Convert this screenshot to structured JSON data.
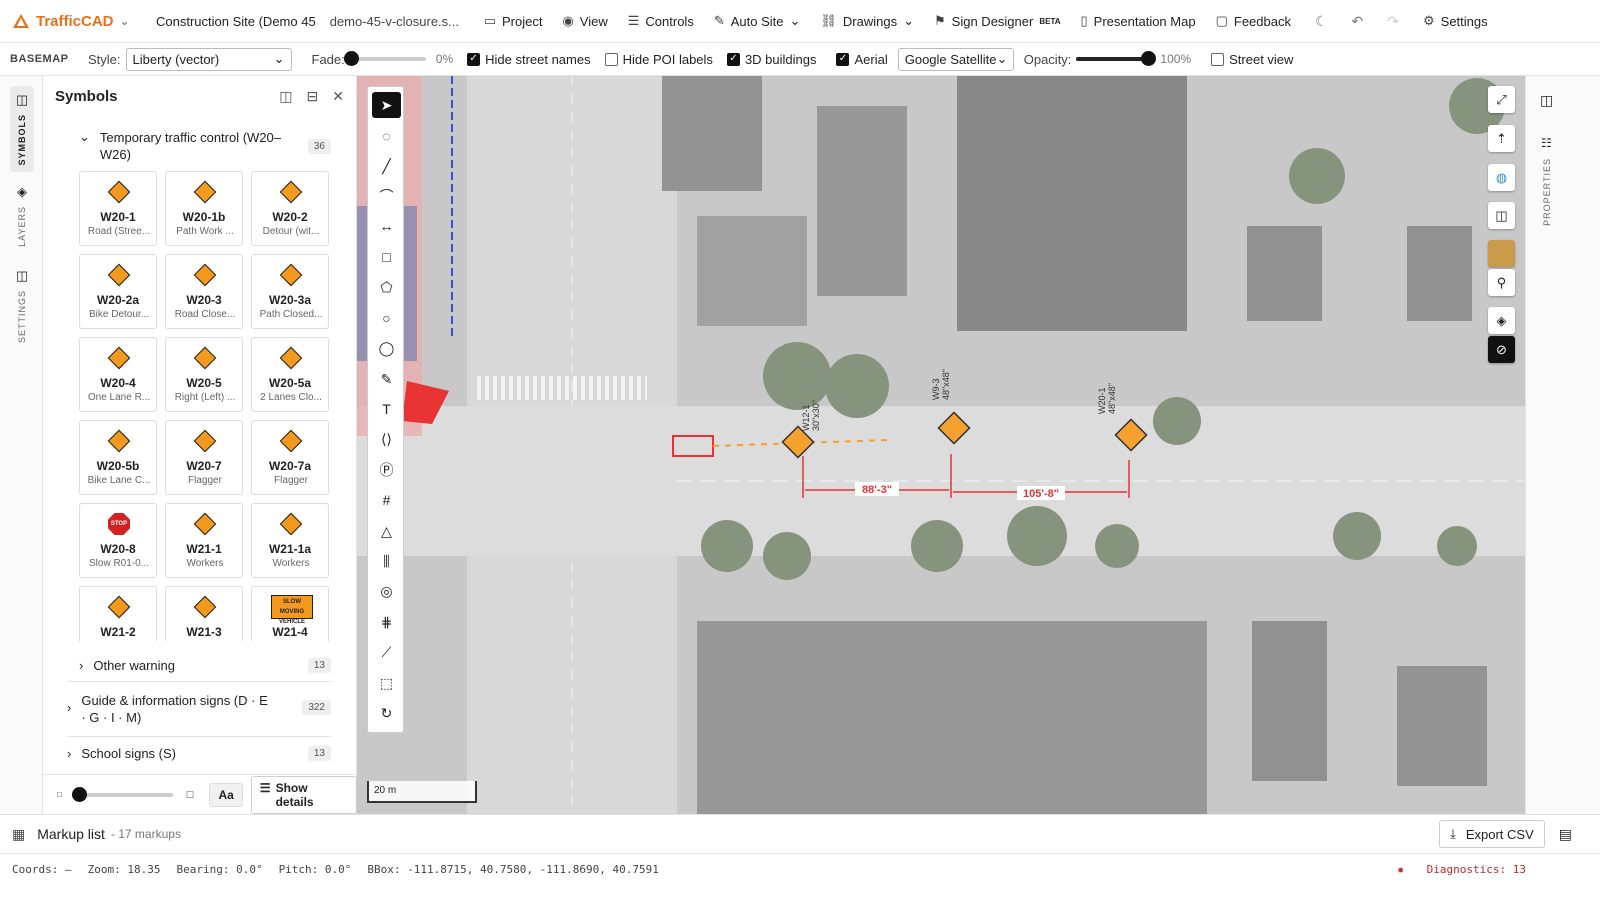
{
  "app": {
    "name": "TrafficCAD"
  },
  "header": {
    "project_title": "Construction Site (Demo 45",
    "file_name": "demo-45-v-closure.s...",
    "menus": [
      {
        "label": "Project",
        "icon": "folder-icon"
      },
      {
        "label": "View",
        "icon": "eye-icon"
      },
      {
        "label": "Controls",
        "icon": "sliders-icon"
      },
      {
        "label": "Auto Site",
        "icon": "magic-wand-icon"
      },
      {
        "label": "Drawings",
        "icon": "link-icon"
      },
      {
        "label": "Sign Designer",
        "icon": "signpost-icon",
        "badge": "BETA"
      },
      {
        "label": "Presentation Map",
        "icon": "book-icon"
      },
      {
        "label": "Feedback",
        "icon": "chat-icon"
      }
    ],
    "settings_label": "Settings"
  },
  "basemap": {
    "title": "BASEMAP",
    "style_label": "Style:",
    "style_value": "Liberty (vector)",
    "fade_label": "Fade:",
    "fade_pct": "0%",
    "fade_value": 0,
    "hide_street_names": {
      "label": "Hide street names",
      "checked": true
    },
    "hide_poi_labels": {
      "label": "Hide POI labels",
      "checked": false
    },
    "buildings_3d": {
      "label": "3D buildings",
      "checked": true
    },
    "aerial": {
      "label": "Aerial",
      "checked": true
    },
    "aerial_source": "Google Satellite",
    "opacity_label": "Opacity:",
    "opacity_pct": "100%",
    "opacity_value": 1.0,
    "street_view": {
      "label": "Street view",
      "checked": false
    }
  },
  "left_rail": {
    "symbols": "SYMBOLS",
    "layers": "LAYERS",
    "settings": "SETTINGS"
  },
  "symbols_panel": {
    "title": "Symbols",
    "open_group": {
      "label": "Temporary traffic control (W20–W26)",
      "count": "36"
    },
    "tiles": [
      {
        "code": "W20-1",
        "desc": "Road (Stree...",
        "kind": "diamond"
      },
      {
        "code": "W20-1b",
        "desc": "Path Work ...",
        "kind": "diamond"
      },
      {
        "code": "W20-2",
        "desc": "Detour (wit...",
        "kind": "diamond"
      },
      {
        "code": "W20-2a",
        "desc": "Bike Detour...",
        "kind": "diamond"
      },
      {
        "code": "W20-3",
        "desc": "Road Close...",
        "kind": "diamond"
      },
      {
        "code": "W20-3a",
        "desc": "Path Closed...",
        "kind": "diamond"
      },
      {
        "code": "W20-4",
        "desc": "One Lane R...",
        "kind": "diamond"
      },
      {
        "code": "W20-5",
        "desc": "Right (Left) ...",
        "kind": "diamond"
      },
      {
        "code": "W20-5a",
        "desc": "2 Lanes Clo...",
        "kind": "diamond"
      },
      {
        "code": "W20-5b",
        "desc": "Bike Lane C...",
        "kind": "diamond"
      },
      {
        "code": "W20-7",
        "desc": "Flagger",
        "kind": "diamond"
      },
      {
        "code": "W20-7a",
        "desc": "Flagger",
        "kind": "diamond"
      },
      {
        "code": "W20-8",
        "desc": "Slow R01-0...",
        "kind": "stop"
      },
      {
        "code": "W21-1",
        "desc": "Workers",
        "kind": "diamond"
      },
      {
        "code": "W21-1a",
        "desc": "Workers",
        "kind": "diamond"
      },
      {
        "code": "W21-2",
        "desc": "",
        "kind": "diamond"
      },
      {
        "code": "W21-3",
        "desc": "",
        "kind": "diamond"
      },
      {
        "code": "W21-4",
        "desc": "",
        "kind": "rect",
        "sign_text": "SLOW MOVING VEHICLE"
      }
    ],
    "stop_text": "STOP",
    "other_groups": [
      {
        "label": "Other warning",
        "count": "13"
      },
      {
        "label": "Guide & information signs (D · E · G · I · M)",
        "count": "322"
      },
      {
        "label": "School signs (S)",
        "count": "13"
      }
    ],
    "font_toggle": "Aa",
    "show_details": "Show details"
  },
  "map": {
    "scale_label": "20 m",
    "signs": [
      {
        "code": "W12-1",
        "size": "30\"x30\""
      },
      {
        "code": "W9-3",
        "size": "48\"x48\""
      },
      {
        "code": "W20-1",
        "size": "48\"x48\""
      }
    ],
    "dimensions": [
      "88'-3\"",
      "105'-8\""
    ]
  },
  "right_rail": {
    "properties": "PROPERTIES"
  },
  "markup": {
    "title": "Markup list",
    "count_text": "- 17 markups",
    "export_label": "Export CSV"
  },
  "status": {
    "coords": "Coords: —",
    "zoom": "Zoom: 18.35",
    "bearing": "Bearing: 0.0°",
    "pitch": "Pitch: 0.0°",
    "bbox": "BBox: -111.8715, 40.7580, -111.8690, 40.7591",
    "diagnostics": "Diagnostics: 13"
  },
  "colors": {
    "accent": "#e8711c",
    "sign_orange": "#f39a1e",
    "markup_red": "#e52222",
    "diag_red": "#c62828"
  }
}
